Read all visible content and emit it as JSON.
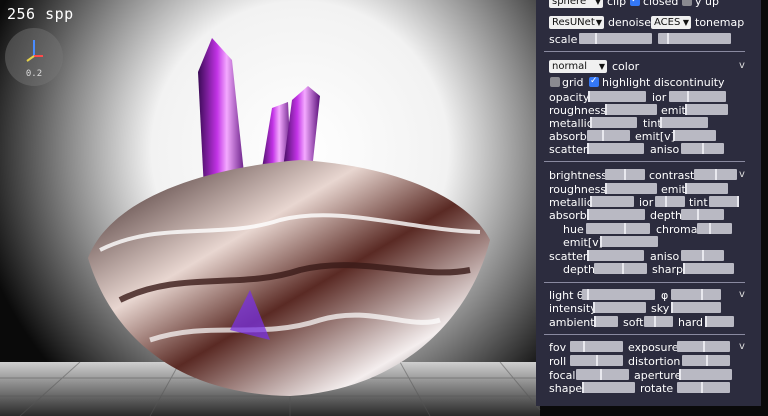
{
  "render": {
    "spp_text": "256 spp",
    "gizmo_scale": "0.2"
  },
  "panel": {
    "top": {
      "row0": {
        "select": "sphere",
        "clip_label": "clip",
        "closed_label": "closed",
        "yup_label": "y up"
      },
      "row1": {
        "denoiser": "ResUNet",
        "denoise_label": "denoise",
        "tonemapper": "ACES",
        "tonemap_label": "tonemap"
      },
      "row2": {
        "scale_label": "scale"
      }
    },
    "material": {
      "mode_select": "normal",
      "color_label": "color",
      "chevron": "v",
      "grid_label": "grid",
      "highlight_label": "highlight discontinuity",
      "opacity": "opacity",
      "ior": "ior",
      "roughness": "roughness",
      "emit": "emit",
      "metallic": "metallic",
      "tint": "tint",
      "absorb": "absorb",
      "emit_v": "emit[v]",
      "scatter": "scatter",
      "aniso": "aniso"
    },
    "surface": {
      "brightness": "brightness",
      "contrast": "contrast",
      "chevron": "v",
      "roughness": "roughness",
      "emit": "emit",
      "metallic": "metallic",
      "ior": "ior",
      "tint": "tint",
      "absorb": "absorb",
      "depth": "depth",
      "hue": "hue",
      "chroma": "chroma",
      "emit_v": "emit[v]",
      "scatter": "scatter",
      "aniso": "aniso",
      "depth2": "depth",
      "sharp": "sharp"
    },
    "light": {
      "theta": "light θ",
      "phi": "φ",
      "chevron": "v",
      "intensity": "intensity",
      "sky": "sky",
      "ambient": "ambient",
      "soft": "soft",
      "hard": "hard"
    },
    "camera": {
      "fov": "fov",
      "exposure": "exposure",
      "chevron": "v",
      "roll": "roll",
      "distortion": "distortion",
      "focal": "focal",
      "aperture": "aperture",
      "shape": "shape",
      "rotate": "rotate"
    }
  }
}
